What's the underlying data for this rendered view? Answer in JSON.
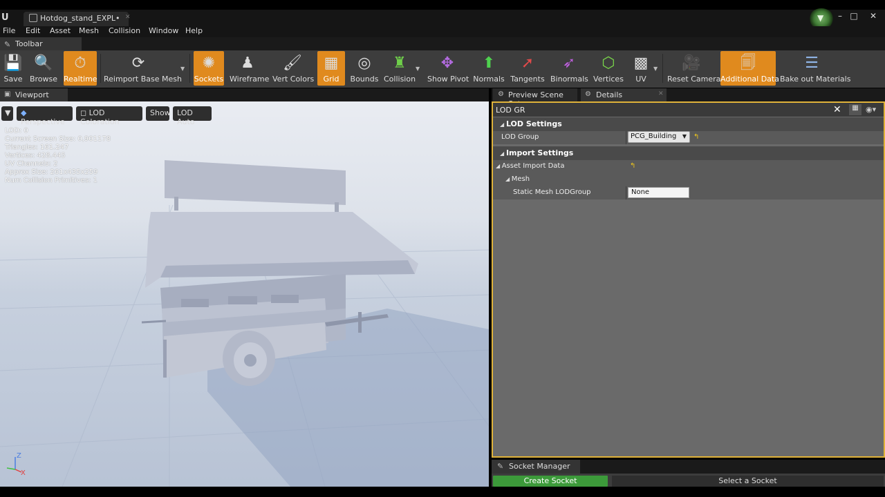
{
  "window": {
    "doc_tab": "Hotdog_stand_EXPL•",
    "min": "–",
    "max": "□",
    "close": "✕"
  },
  "menu": [
    "File",
    "Edit",
    "Asset",
    "Mesh",
    "Collision",
    "Window",
    "Help"
  ],
  "toolbar": {
    "tab_label": "Toolbar",
    "buttons": [
      {
        "label": "Save",
        "icon": "save-icon",
        "active": false
      },
      {
        "label": "Browse",
        "icon": "browse-icon",
        "active": false
      },
      {
        "label": "Realtime",
        "icon": "realtime-icon",
        "active": true
      },
      {
        "label": "Reimport Base Mesh",
        "icon": "reimport-icon",
        "active": false
      },
      {
        "label": "Sockets",
        "icon": "sockets-icon",
        "active": true
      },
      {
        "label": "Wireframe",
        "icon": "wireframe-icon",
        "active": false
      },
      {
        "label": "Vert Colors",
        "icon": "vert-colors-icon",
        "active": false
      },
      {
        "label": "Grid",
        "icon": "grid-icon",
        "active": true
      },
      {
        "label": "Bounds",
        "icon": "bounds-icon",
        "active": false
      },
      {
        "label": "Collision",
        "icon": "collision-icon",
        "active": false
      },
      {
        "label": "Show Pivot",
        "icon": "pivot-icon",
        "active": false
      },
      {
        "label": "Normals",
        "icon": "normals-icon",
        "active": false
      },
      {
        "label": "Tangents",
        "icon": "tangents-icon",
        "active": false
      },
      {
        "label": "Binormals",
        "icon": "binormals-icon",
        "active": false
      },
      {
        "label": "Vertices",
        "icon": "vertices-icon",
        "active": false
      },
      {
        "label": "UV",
        "icon": "uv-icon",
        "active": false
      },
      {
        "label": "Reset Camera",
        "icon": "camera-icon",
        "active": false
      },
      {
        "label": "Additional Data",
        "icon": "additional-data-icon",
        "active": true
      },
      {
        "label": "Bake out Materials",
        "icon": "bake-materials-icon",
        "active": false
      }
    ]
  },
  "viewport": {
    "tab_label": "Viewport",
    "perspective": "Perspective",
    "lod_coloration": "LOD Coloration",
    "show": "Show",
    "lod_auto": "LOD Auto",
    "stats": [
      "LOD:  0",
      "Current Screen Size:  0,901178",
      "Triangles:  161.247",
      "Vertices:  428.445",
      "UV Channels:  2",
      "Approx Size: 261x435x259",
      "Num Collision Primitives:  1"
    ],
    "axis_z": "Z",
    "axis_x": "X"
  },
  "right_panel": {
    "tab_preview": "Preview Scene Set",
    "tab_details": "Details",
    "search_value": "LOD GR",
    "lod_settings": "LOD Settings",
    "lod_group_label": "LOD Group",
    "lod_group_value": "PCG_Building",
    "import_settings": "Import Settings",
    "asset_import_data": "Asset Import Data",
    "mesh": "Mesh",
    "static_mesh_lodgroup": "Static Mesh LODGroup",
    "static_mesh_lodgroup_value": "None"
  },
  "socket_manager": {
    "tab_label": "Socket Manager",
    "create_socket": "Create Socket",
    "hint": "Select a Socket"
  },
  "colors": {
    "accent_orange": "#e08a1e",
    "details_border": "#e0b33a",
    "create_green": "#3c9a3a"
  }
}
